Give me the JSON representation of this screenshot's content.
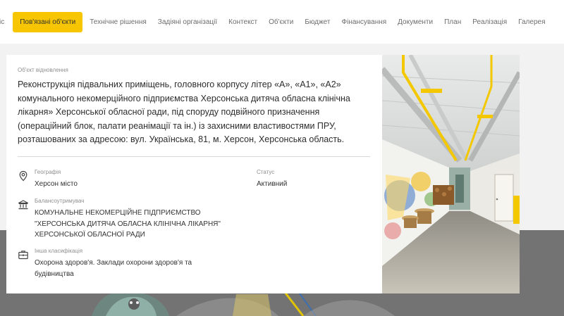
{
  "nav": {
    "tabs": [
      {
        "label": "іс",
        "active": false
      },
      {
        "label": "Пов'язані об'єкти",
        "active": true
      },
      {
        "label": "Технічне рішення",
        "active": false
      },
      {
        "label": "Задіяні організації",
        "active": false
      },
      {
        "label": "Контекст",
        "active": false
      },
      {
        "label": "Об'єкти",
        "active": false
      },
      {
        "label": "Бюджет",
        "active": false
      },
      {
        "label": "Фінансування",
        "active": false
      },
      {
        "label": "Документи",
        "active": false
      },
      {
        "label": "План",
        "active": false
      },
      {
        "label": "Реалізація",
        "active": false
      },
      {
        "label": "Галерея",
        "active": false
      }
    ]
  },
  "card": {
    "eyebrow": "Об'єкт відновлення",
    "title": "Реконструкція підвальних приміщень, головного корпусу літер «А», «А1», «А2» комунального некомерційного підприємства Херсонська дитяча обласна клінічна лікарня» Херсонської обласної ради, під споруду подвійного призначення (операційний блок, палати реанімації та ін.) із захисними властивостями ПРУ, розташованих за адресою: вул. Українська, 81, м. Херсон, Херсонська область.",
    "geography": {
      "label": "Географія",
      "value": "Херсон місто",
      "icon": "map-pin-icon"
    },
    "status": {
      "label": "Статус",
      "value": "Активний"
    },
    "balance_holder": {
      "label": "Балансоутримувач",
      "value": "КОМУНАЛЬНЕ НЕКОМЕРЦІЙНЕ ПІДПРИЄМСТВО \"ХЕРСОНСЬКА ДИТЯЧА ОБЛАСНА КЛІНІЧНА ЛІКАРНЯ\" ХЕРСОНСЬКОЇ ОБЛАСНОЇ РАДИ",
      "icon": "bank-icon"
    },
    "classification": {
      "label": "Інша класифікація",
      "value": "Охорона здоров'я. Заклади охорони здоров'я та будівництва",
      "icon": "briefcase-icon"
    },
    "photo": "corridor-photo"
  },
  "colors": {
    "accent": "#f7c600",
    "background": "#f2f2f2",
    "band": "#737373"
  }
}
